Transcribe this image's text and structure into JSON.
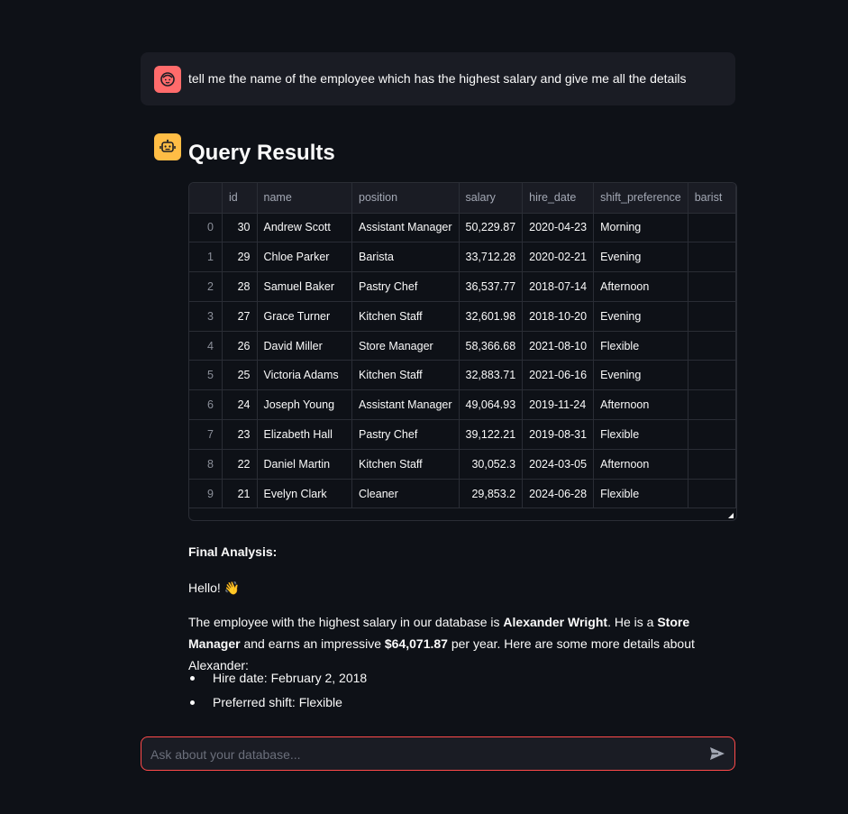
{
  "user_message": {
    "text": "tell me the name of the employee which has the highest salary and give me all the details",
    "avatar_icon": "user-face-icon",
    "avatar_color": "#ff6b6b"
  },
  "assistant": {
    "avatar_icon": "robot-icon",
    "avatar_color": "#ffbd45",
    "title": "Query Results"
  },
  "table": {
    "columns": [
      "",
      "id",
      "name",
      "position",
      "salary",
      "hire_date",
      "shift_preference",
      "barist"
    ],
    "rows": [
      [
        "0",
        "30",
        "Andrew Scott",
        "Assistant Manager",
        "50,229.87",
        "2020-04-23",
        "Morning",
        ""
      ],
      [
        "1",
        "29",
        "Chloe Parker",
        "Barista",
        "33,712.28",
        "2020-02-21",
        "Evening",
        ""
      ],
      [
        "2",
        "28",
        "Samuel Baker",
        "Pastry Chef",
        "36,537.77",
        "2018-07-14",
        "Afternoon",
        ""
      ],
      [
        "3",
        "27",
        "Grace Turner",
        "Kitchen Staff",
        "32,601.98",
        "2018-10-20",
        "Evening",
        ""
      ],
      [
        "4",
        "26",
        "David Miller",
        "Store Manager",
        "58,366.68",
        "2021-08-10",
        "Flexible",
        ""
      ],
      [
        "5",
        "25",
        "Victoria Adams",
        "Kitchen Staff",
        "32,883.71",
        "2021-06-16",
        "Evening",
        ""
      ],
      [
        "6",
        "24",
        "Joseph Young",
        "Assistant Manager",
        "49,064.93",
        "2019-11-24",
        "Afternoon",
        ""
      ],
      [
        "7",
        "23",
        "Elizabeth Hall",
        "Pastry Chef",
        "39,122.21",
        "2019-08-31",
        "Flexible",
        ""
      ],
      [
        "8",
        "22",
        "Daniel Martin",
        "Kitchen Staff",
        "30,052.3",
        "2024-03-05",
        "Afternoon",
        ""
      ],
      [
        "9",
        "21",
        "Evelyn Clark",
        "Cleaner",
        "29,853.2",
        "2024-06-28",
        "Flexible",
        ""
      ]
    ]
  },
  "analysis": {
    "heading": "Final Analysis:",
    "greeting": "Hello!",
    "greeting_emoji": "👋",
    "para_intro": "The employee with the highest salary in our database is ",
    "name": "Alexander Wright",
    "para_mid1": ". He is a ",
    "role": "Store Manager",
    "para_mid2": " and earns an impressive ",
    "salary": "$64,071.87",
    "para_end": " per year. Here are some more details about Alexander:",
    "bullets": [
      "Hire date: February 2, 2018",
      "Preferred shift: Flexible"
    ]
  },
  "chat_input": {
    "placeholder": "Ask about your database...",
    "value": "",
    "send_icon": "send-icon",
    "border_color": "#ff4b4b"
  }
}
